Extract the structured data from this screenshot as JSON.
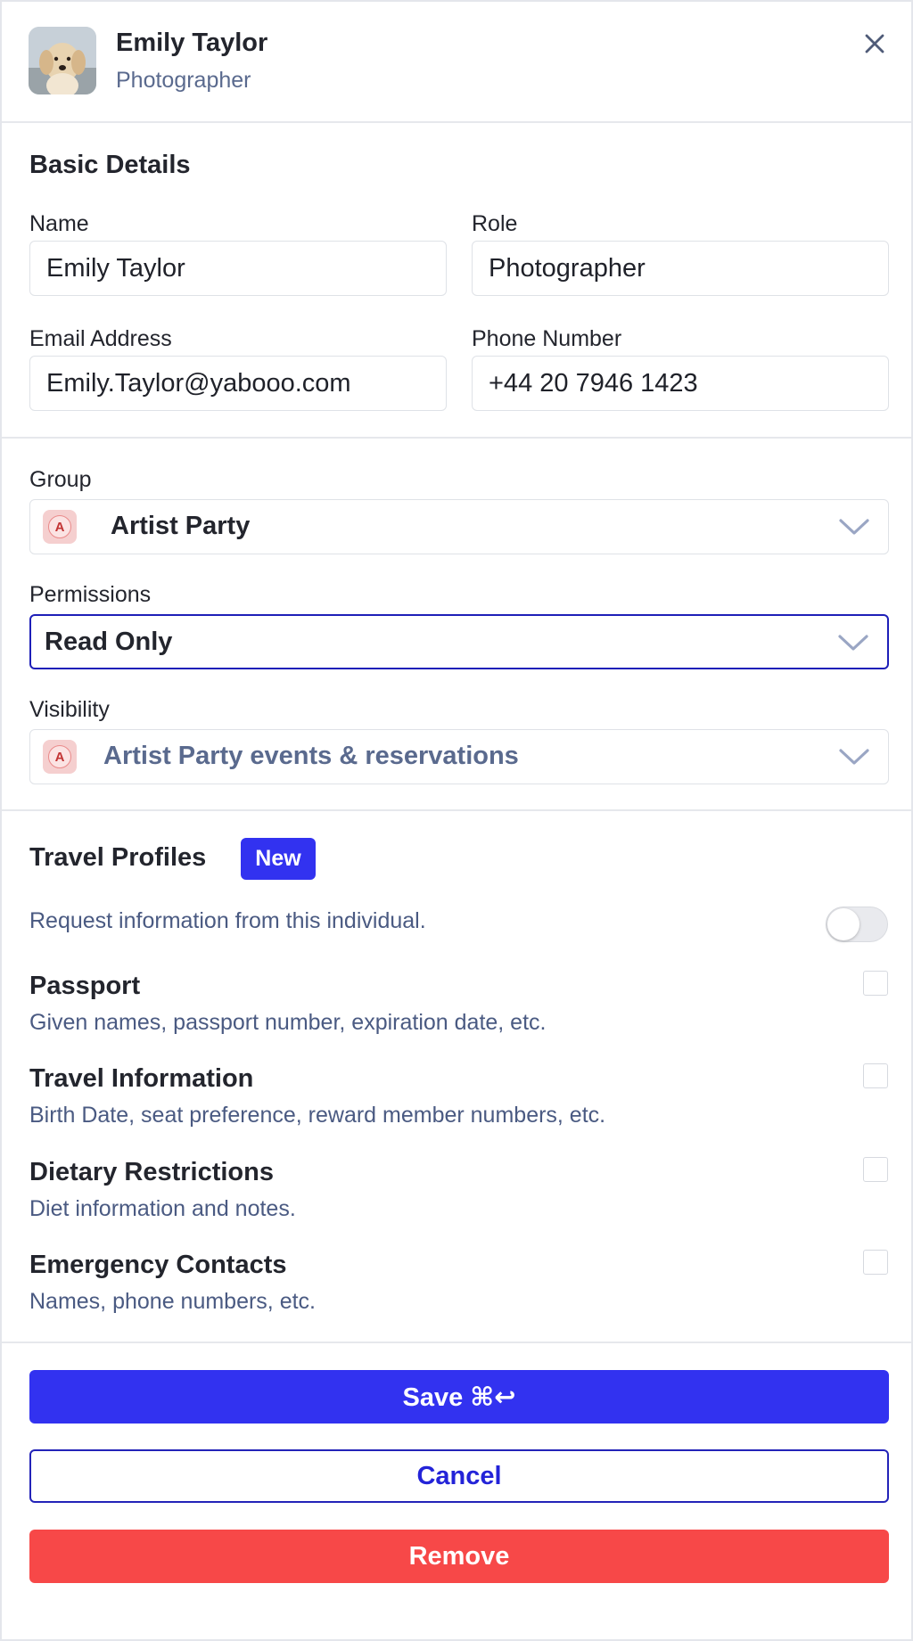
{
  "header": {
    "name": "Emily Taylor",
    "role": "Photographer"
  },
  "basic_details": {
    "title": "Basic Details",
    "name_label": "Name",
    "name_value": "Emily Taylor",
    "role_label": "Role",
    "role_value": "Photographer",
    "email_label": "Email Address",
    "email_value": "Emily.Taylor@yabooo.com",
    "phone_label": "Phone Number",
    "phone_value": "+44 20 7946 1423"
  },
  "group": {
    "label": "Group",
    "badge_letter": "A",
    "value": "Artist Party"
  },
  "permissions": {
    "label": "Permissions",
    "value": "Read Only"
  },
  "visibility": {
    "label": "Visibility",
    "badge_letter": "A",
    "value": "Artist Party events & reservations"
  },
  "travel_profiles": {
    "title": "Travel Profiles",
    "badge": "New",
    "request_text": "Request information from this individual.",
    "request_enabled": false,
    "items": [
      {
        "title": "Passport",
        "desc": "Given names, passport number, expiration date, etc.",
        "checked": false
      },
      {
        "title": "Travel Information",
        "desc": "Birth Date, seat preference, reward member numbers, etc.",
        "checked": false
      },
      {
        "title": "Dietary Restrictions",
        "desc": "Diet information and notes.",
        "checked": false
      },
      {
        "title": "Emergency Contacts",
        "desc": "Names, phone numbers, etc.",
        "checked": false
      }
    ]
  },
  "actions": {
    "save_label": "Save ⌘↩",
    "cancel_label": "Cancel",
    "remove_label": "Remove"
  },
  "colors": {
    "primary": "#3232f0",
    "danger": "#f74848",
    "muted_text": "#4a5a82",
    "focus_border": "#1e1fb8"
  },
  "icons": {
    "close": "close-icon",
    "chevron": "chevron-down-icon"
  }
}
